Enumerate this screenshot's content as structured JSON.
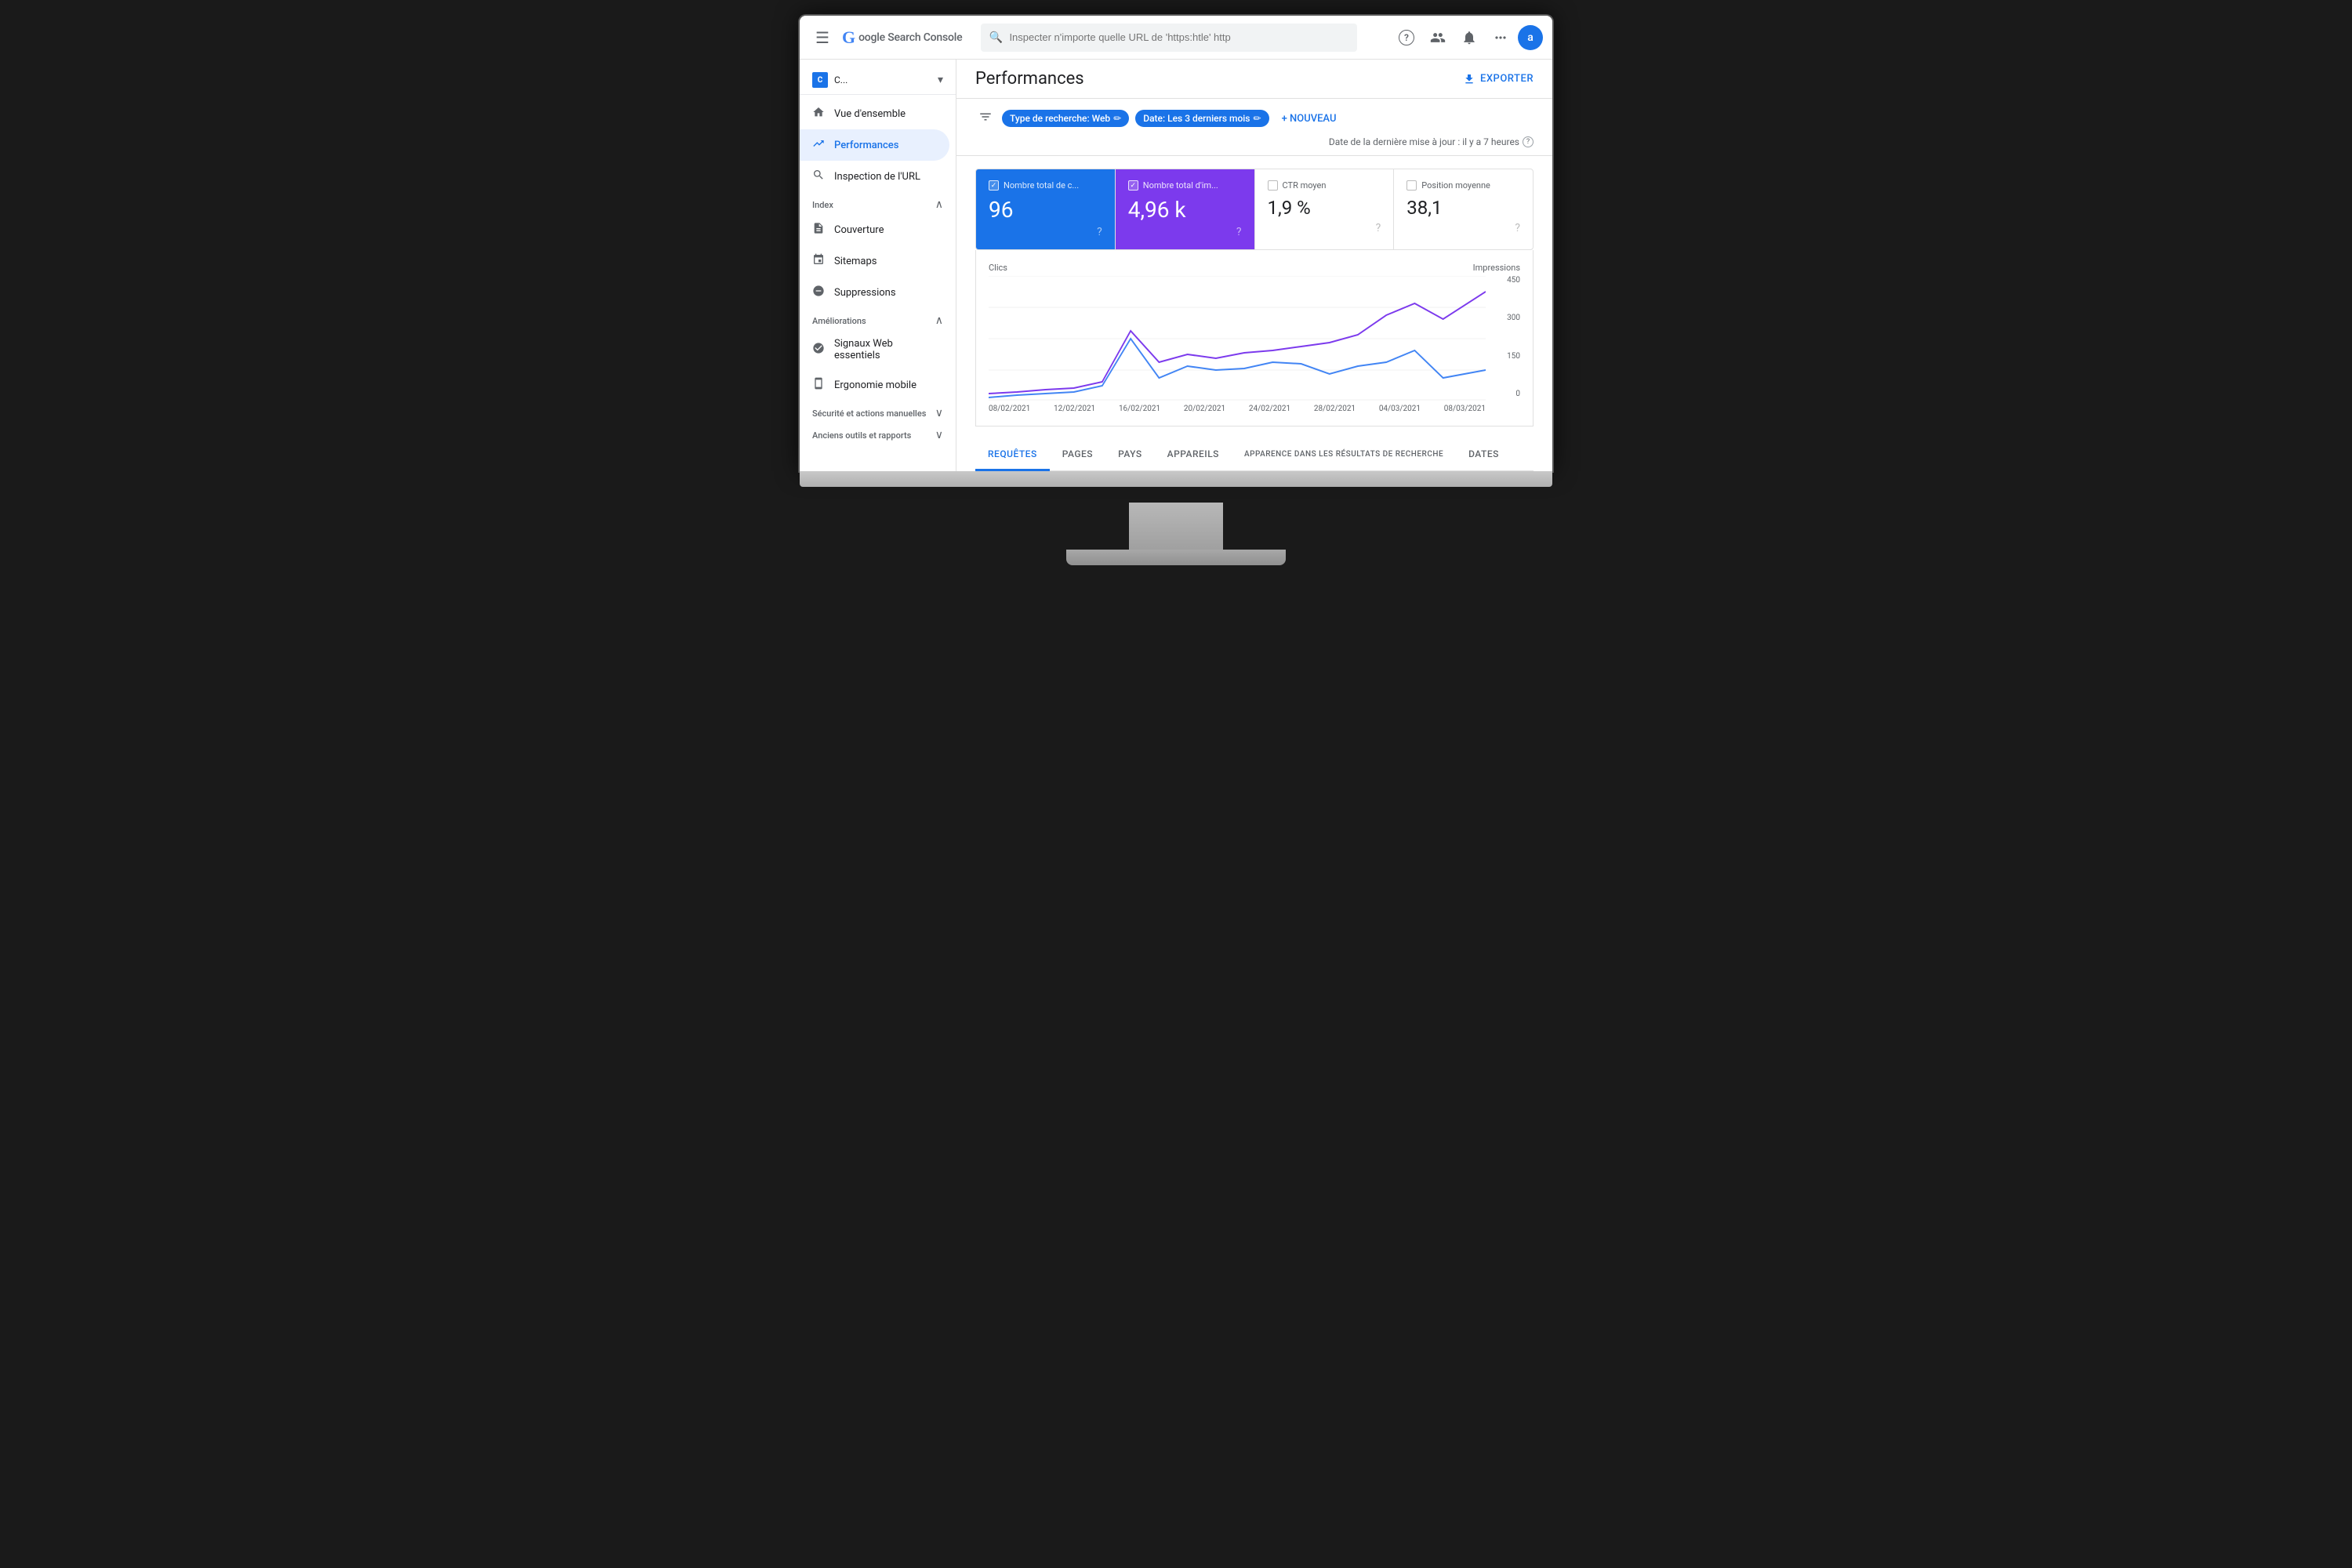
{
  "topbar": {
    "logo_g": "G",
    "logo_text": "oogle Search Console",
    "search_placeholder": "Inspecter n'importe quelle URL de 'https:htle' http",
    "help_icon": "?",
    "users_icon": "👤",
    "notif_icon": "🔔",
    "apps_icon": "⋮⋮⋮",
    "avatar_label": "a"
  },
  "sidebar": {
    "property_icon": "C",
    "property_name": "C...",
    "nav_items": [
      {
        "label": "Vue d'ensemble",
        "icon": "🏠",
        "active": false
      },
      {
        "label": "Performances",
        "icon": "↗",
        "active": true
      },
      {
        "label": "Inspection de l'URL",
        "icon": "🔍",
        "active": false
      }
    ],
    "sections": [
      {
        "label": "Index",
        "items": [
          {
            "label": "Couverture",
            "icon": "📄"
          },
          {
            "label": "Sitemaps",
            "icon": "📊"
          },
          {
            "label": "Suppressions",
            "icon": "🚫"
          }
        ]
      },
      {
        "label": "Améliorations",
        "items": [
          {
            "label": "Signaux Web essentiels",
            "icon": "⚡"
          },
          {
            "label": "Ergonomie mobile",
            "icon": "📱"
          }
        ]
      },
      {
        "label": "Sécurité et actions manuelles",
        "items": []
      },
      {
        "label": "Anciens outils et rapports",
        "items": []
      }
    ]
  },
  "content": {
    "page_title": "Performances",
    "export_label": "EXPORTER",
    "filters": {
      "filter_icon": "≡",
      "chips": [
        {
          "label": "Type de recherche: Web",
          "edit": "✏"
        },
        {
          "label": "Date: Les 3 derniers mois",
          "edit": "✏"
        }
      ],
      "new_label": "+ NOUVEAU",
      "update_text": "Date de la dernière mise à jour : il y a 7 heures",
      "update_help": "?"
    },
    "metrics": [
      {
        "label": "Nombre total de c...",
        "value": "96",
        "selected": "blue",
        "checked": true
      },
      {
        "label": "Nombre total d'im...",
        "value": "4,96 k",
        "selected": "purple",
        "checked": true
      },
      {
        "label": "CTR moyen",
        "value": "1,9 %",
        "selected": "none",
        "checked": false
      },
      {
        "label": "Position moyenne",
        "value": "38,1",
        "selected": "none",
        "checked": false
      }
    ],
    "chart": {
      "left_label": "Clics",
      "right_label": "Impressions",
      "y_right_max": "450",
      "y_right_mid": "300",
      "y_right_low": "150",
      "y_right_min": "0",
      "y_left_max": "",
      "x_labels": [
        "08/02/2021",
        "12/02/2021",
        "16/02/2021",
        "20/02/2021",
        "24/02/2021",
        "28/02/2021",
        "04/03/2021",
        "08/03/2021"
      ]
    },
    "tabs": [
      {
        "label": "REQUÊTES",
        "active": true
      },
      {
        "label": "PAGES",
        "active": false
      },
      {
        "label": "PAYS",
        "active": false
      },
      {
        "label": "APPAREILS",
        "active": false
      },
      {
        "label": "APPARENCE DANS LES RÉSULTATS DE RECHERCHE",
        "active": false
      },
      {
        "label": "DATES",
        "active": false
      }
    ]
  },
  "monitor": {
    "apple_logo": ""
  }
}
